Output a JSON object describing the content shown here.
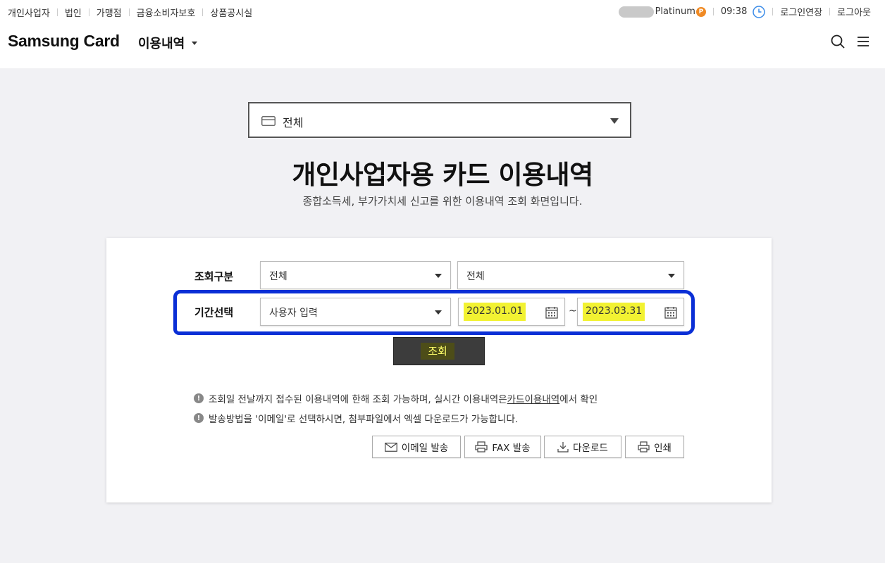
{
  "topbar": {
    "links": [
      "개인사업자",
      "법인",
      "가맹점",
      "금융소비자보호",
      "상품공시실"
    ],
    "grade": "Platinum",
    "grade_badge": "P",
    "time": "09:38",
    "extend_login": "로그인연장",
    "logout": "로그아웃"
  },
  "header": {
    "logo": "Samsung Card",
    "menu_title": "이용내역",
    "icons": [
      "search-icon",
      "hamburger-menu-icon"
    ]
  },
  "card_selector": {
    "value": "전체"
  },
  "page": {
    "title": "개인사업자용 카드 이용내역",
    "subtitle": "종합소득세, 부가가치세 신고를 위한 이용내역 조회 화면입니다."
  },
  "form": {
    "inquiry_type_label": "조회구분",
    "inquiry_type_1": "전체",
    "inquiry_type_2": "전체",
    "period_label": "기간선택",
    "period_option": "사용자 입력",
    "start_date": "2023.01.01",
    "tilde": "~",
    "end_date": "2023.03.31",
    "search_button": "조회"
  },
  "notes": {
    "note1_prefix": "조회일 전날까지 접수된 이용내역에 한해 조회 가능하며, 실시간 이용내역은 ",
    "note1_link": "카드이용내역",
    "note1_suffix": "에서 확인",
    "note2": "발송방법을 '이메일'로 선택하시면, 첨부파일에서 엑셀 다운로드가 가능합니다.",
    "icon": "!"
  },
  "actions": {
    "email": "이메일 발송",
    "fax": "FAX 발송",
    "download": "다운로드",
    "print": "인쇄"
  },
  "colors": {
    "highlight_yellow": "#f2f232",
    "annotation_blue": "#0a2fd6",
    "search_button_bg": "#3c3c3c",
    "grade_badge": "#f08a24"
  }
}
